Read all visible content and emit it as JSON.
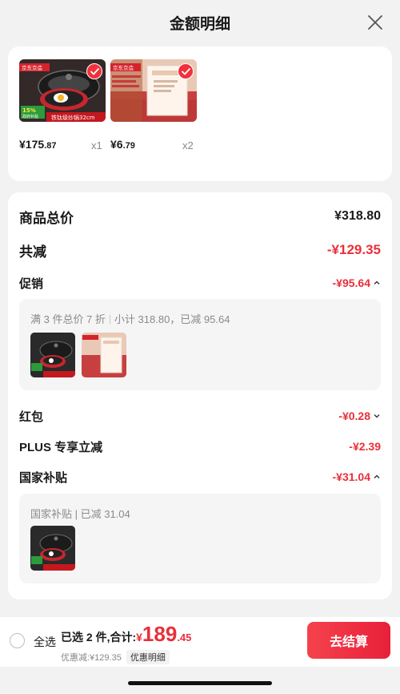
{
  "header": {
    "title": "金额明细"
  },
  "products": [
    {
      "price_int": "¥175",
      "price_dec": ".87",
      "qty": "x1",
      "thumb_badge": "京东京造",
      "thumb_text": "铁钛级炒锅32cm",
      "thumb_tag": "15%",
      "thumb_tag_sub": "政府补贴"
    },
    {
      "price_int": "¥6",
      "price_dec": ".79",
      "qty": "x2",
      "thumb_badge": "京东京造"
    }
  ],
  "details": {
    "total_label": "商品总价",
    "total_value": "¥318.80",
    "reduce_label": "共减",
    "reduce_value": "-¥129.35",
    "promo_label": "促销",
    "promo_value": "-¥95.64",
    "promo_box_main": "满 3 件总价 7 折",
    "promo_box_sub": "小计 318.80，已减 95.64",
    "redpacket_label": "红包",
    "redpacket_value": "-¥0.28",
    "plus_label": "PLUS 专享立减",
    "plus_value": "-¥2.39",
    "subsidy_label": "国家补贴",
    "subsidy_value": "-¥31.04",
    "subsidy_box_text": "国家补贴 | 已减 31.04"
  },
  "bottom": {
    "select_all": "全选",
    "selected_prefix": "已选 2 件,合计:",
    "yen": "¥",
    "total_int": "189",
    "total_dec": ".45",
    "savings": "优惠减:¥129.35",
    "detail_link": "优惠明细",
    "checkout": "去结算"
  },
  "colors": {
    "accent": "#e8303a",
    "background": "#f2f2f2"
  }
}
